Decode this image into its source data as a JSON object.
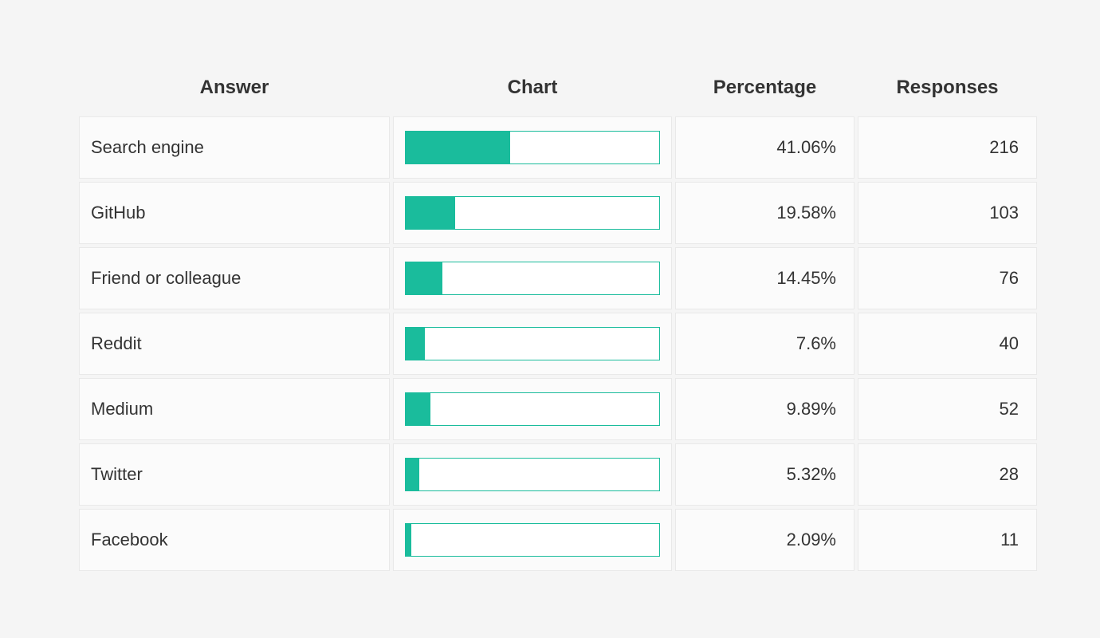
{
  "columns": {
    "answer": "Answer",
    "chart": "Chart",
    "percentage": "Percentage",
    "responses": "Responses"
  },
  "rows": [
    {
      "answer": "Search engine",
      "percentage": 41.06,
      "percentage_label": "41.06%",
      "responses": 216
    },
    {
      "answer": "GitHub",
      "percentage": 19.58,
      "percentage_label": "19.58%",
      "responses": 103
    },
    {
      "answer": "Friend or colleague",
      "percentage": 14.45,
      "percentage_label": "14.45%",
      "responses": 76
    },
    {
      "answer": "Reddit",
      "percentage": 7.6,
      "percentage_label": "7.6%",
      "responses": 40
    },
    {
      "answer": "Medium",
      "percentage": 9.89,
      "percentage_label": "9.89%",
      "responses": 52
    },
    {
      "answer": "Twitter",
      "percentage": 5.32,
      "percentage_label": "5.32%",
      "responses": 28
    },
    {
      "answer": "Facebook",
      "percentage": 2.09,
      "percentage_label": "2.09%",
      "responses": 11
    }
  ],
  "colors": {
    "accent": "#1abc9c",
    "cell_border": "#e9e9e9",
    "cell_bg": "#fbfbfb",
    "text": "#333333",
    "page_bg": "#f5f5f5"
  },
  "chart_data": {
    "type": "bar",
    "orientation": "horizontal",
    "title": "",
    "xlabel": "",
    "ylabel": "",
    "xlim": [
      0,
      100
    ],
    "categories": [
      "Search engine",
      "GitHub",
      "Friend or colleague",
      "Reddit",
      "Medium",
      "Twitter",
      "Facebook"
    ],
    "series": [
      {
        "name": "Percentage",
        "values": [
          41.06,
          19.58,
          14.45,
          7.6,
          9.89,
          5.32,
          2.09
        ]
      },
      {
        "name": "Responses",
        "values": [
          216,
          103,
          76,
          40,
          52,
          28,
          11
        ]
      }
    ]
  }
}
